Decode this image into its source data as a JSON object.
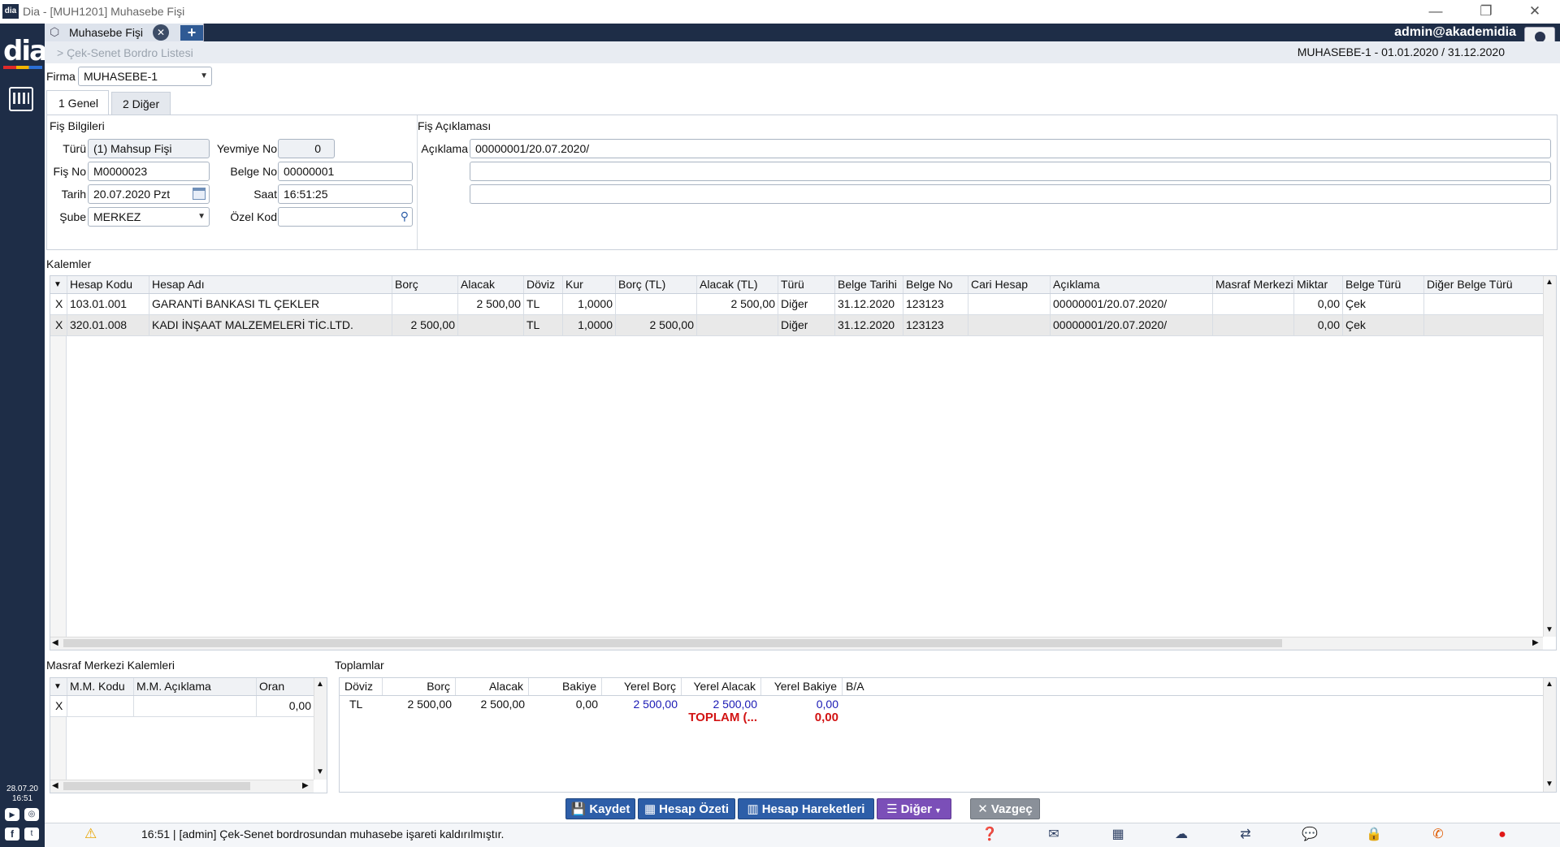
{
  "window": {
    "title": "Dia - [MUH1201] Muhasebe Fişi"
  },
  "rail": {
    "logo": "dia",
    "date": "28.07.20",
    "time": "16:51"
  },
  "tabs": {
    "doc_tab": "Muhasebe Fişi",
    "add": "+",
    "close": "✕"
  },
  "user": {
    "name": "admin@akademidia"
  },
  "breadcrumb": {
    "text": "> Çek-Senet Bordro Listesi"
  },
  "period": {
    "text": "MUHASEBE-1 -  01.01.2020 / 31.12.2020"
  },
  "firma": {
    "label": "Firma",
    "value": "MUHASEBE-1"
  },
  "subtabs": [
    {
      "label": "1 Genel"
    },
    {
      "label": "2 Diğer"
    }
  ],
  "fis_bilgileri": {
    "title": "Fiş Bilgileri",
    "turu_label": "Türü",
    "turu_value": "(1) Mahsup Fişi",
    "yevmiye_label": "Yevmiye No",
    "yevmiye_value": "0",
    "fisno_label": "Fiş No",
    "fisno_value": "M0000023",
    "belgeno_label": "Belge No",
    "belgeno_value": "00000001",
    "tarih_label": "Tarih",
    "tarih_value": "20.07.2020 Pzt",
    "saat_label": "Saat",
    "saat_value": "16:51:25",
    "sube_label": "Şube",
    "sube_value": "MERKEZ",
    "ozelkod_label": "Özel Kod",
    "ozelkod_value": ""
  },
  "fis_aciklamasi": {
    "title": "Fiş Açıklaması",
    "aciklama_label": "Açıklama",
    "line1": "00000001/20.07.2020/",
    "line2": "",
    "line3": ""
  },
  "kalemler": {
    "title": "Kalemler",
    "columns": [
      "Hesap Kodu",
      "Hesap Adı",
      "Borç",
      "Alacak",
      "Döviz",
      "Kur",
      "Borç (TL)",
      "Alacak (TL)",
      "Türü",
      "Belge Tarihi",
      "Belge No",
      "Cari Hesap",
      "Açıklama",
      "Masraf Merkezi",
      "Miktar",
      "Belge Türü",
      "Diğer Belge Türü"
    ],
    "rows": [
      {
        "x": "X",
        "hesap_kodu": "103.01.001",
        "hesap_adi": "GARANTİ BANKASI TL ÇEKLER",
        "borc": "",
        "alacak": "2 500,00",
        "doviz": "TL",
        "kur": "1,0000",
        "borc_tl": "",
        "alacak_tl": "2 500,00",
        "turu": "Diğer",
        "belge_tarihi": "31.12.2020",
        "belge_no": "123123",
        "cari_hesap": "",
        "aciklama": "00000001/20.07.2020/",
        "masraf_merkezi": "",
        "miktar": "0,00",
        "belge_turu": "Çek",
        "diger_belge_turu": ""
      },
      {
        "x": "X",
        "hesap_kodu": "320.01.008",
        "hesap_adi": "KADI İNŞAAT MALZEMELERİ TİC.LTD.",
        "borc": "2 500,00",
        "alacak": "",
        "doviz": "TL",
        "kur": "1,0000",
        "borc_tl": "2 500,00",
        "alacak_tl": "",
        "turu": "Diğer",
        "belge_tarihi": "31.12.2020",
        "belge_no": "123123",
        "cari_hesap": "",
        "aciklama": "00000001/20.07.2020/",
        "masraf_merkezi": "",
        "miktar": "0,00",
        "belge_turu": "Çek",
        "diger_belge_turu": ""
      }
    ]
  },
  "masraf": {
    "title": "Masraf Merkezi Kalemleri",
    "columns": [
      "M.M. Kodu",
      "M.M. Açıklama",
      "Oran"
    ],
    "row": {
      "x": "X",
      "kod": "",
      "aciklama": "",
      "oran": "0,00"
    }
  },
  "toplamlar": {
    "title": "Toplamlar",
    "columns": [
      "Döviz",
      "Borç",
      "Alacak",
      "Bakiye",
      "Yerel Borç",
      "Yerel Alacak",
      "Yerel Bakiye",
      "B/A"
    ],
    "row": {
      "doviz": "TL",
      "borc": "2 500,00",
      "alacak": "2 500,00",
      "bakiye": "0,00",
      "yerel_borc": "2 500,00",
      "yerel_alacak": "2 500,00",
      "yerel_bakiye": "0,00",
      "ba": ""
    },
    "total_label": "TOPLAM (...",
    "total_value": "0,00"
  },
  "buttons": {
    "kaydet": "Kaydet",
    "hesap_ozeti": "Hesap Özeti",
    "hesap_hareketleri": "Hesap Hareketleri",
    "diger": "Diğer",
    "vazgec": "Vazgeç"
  },
  "status": {
    "message": "16:51 | [admin] Çek-Senet bordrosundan muhasebe işareti kaldırılmıştır."
  },
  "colors": {
    "nav": "#1e2d47",
    "button_blue": "#2d5ea8",
    "button_purple": "#7b4fb8",
    "total_red": "#d21313",
    "value_blue": "#1a1ab5"
  }
}
